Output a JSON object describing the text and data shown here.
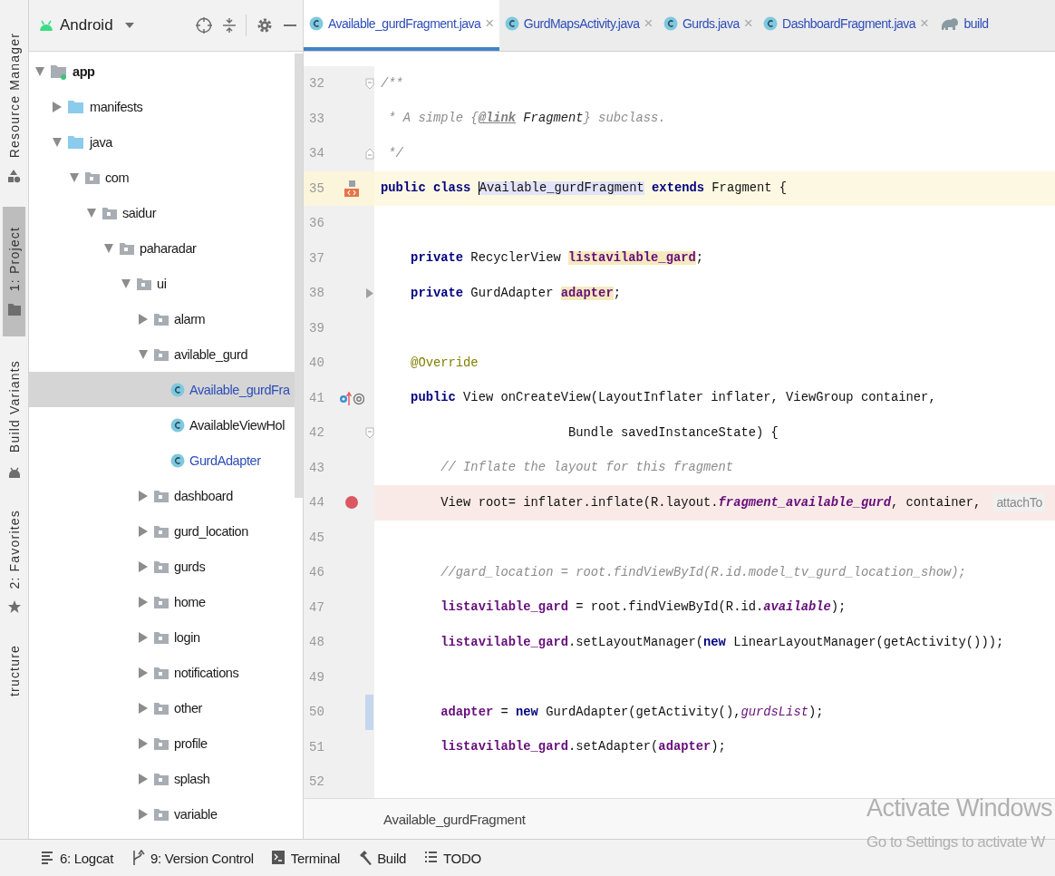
{
  "tool_stripe": [
    {
      "label": "Resource Manager",
      "selected": false
    },
    {
      "label": "1: Project",
      "selected": true
    },
    {
      "label": "Build Variants",
      "selected": false
    },
    {
      "label": "2: Favorites",
      "selected": false
    },
    {
      "label": "tructure",
      "selected": false
    }
  ],
  "project": {
    "view": "Android",
    "tree": [
      {
        "label": "app",
        "kind": "module",
        "expanded": true,
        "selected": false,
        "modified": false,
        "children": [
          {
            "label": "manifests",
            "kind": "source",
            "expanded": false,
            "selected": false,
            "modified": false
          },
          {
            "label": "java",
            "kind": "source",
            "expanded": true,
            "selected": false,
            "modified": false,
            "children": [
              {
                "label": "com",
                "kind": "package",
                "expanded": true,
                "selected": false,
                "modified": false,
                "children": [
                  {
                    "label": "saidur",
                    "kind": "package",
                    "expanded": true,
                    "selected": false,
                    "modified": false,
                    "children": [
                      {
                        "label": "paharadar",
                        "kind": "package",
                        "expanded": true,
                        "selected": false,
                        "modified": false,
                        "children": [
                          {
                            "label": "ui",
                            "kind": "package",
                            "expanded": true,
                            "selected": false,
                            "modified": false,
                            "children": [
                              {
                                "label": "alarm",
                                "kind": "package",
                                "expanded": false,
                                "selected": false,
                                "modified": false
                              },
                              {
                                "label": "avilable_gurd",
                                "kind": "package",
                                "expanded": true,
                                "selected": false,
                                "modified": false,
                                "children": [
                                  {
                                    "label": "Available_gurdFra",
                                    "kind": "class",
                                    "selected": true,
                                    "modified": true
                                  },
                                  {
                                    "label": "AvailableViewHol",
                                    "kind": "class",
                                    "selected": false,
                                    "modified": false
                                  },
                                  {
                                    "label": "GurdAdapter",
                                    "kind": "class",
                                    "selected": false,
                                    "modified": true
                                  }
                                ]
                              },
                              {
                                "label": "dashboard",
                                "kind": "package",
                                "expanded": false,
                                "selected": false,
                                "modified": false
                              },
                              {
                                "label": "gurd_location",
                                "kind": "package",
                                "expanded": false,
                                "selected": false,
                                "modified": false
                              },
                              {
                                "label": "gurds",
                                "kind": "package",
                                "expanded": false,
                                "selected": false,
                                "modified": false
                              },
                              {
                                "label": "home",
                                "kind": "package",
                                "expanded": false,
                                "selected": false,
                                "modified": false
                              },
                              {
                                "label": "login",
                                "kind": "package",
                                "expanded": false,
                                "selected": false,
                                "modified": false
                              },
                              {
                                "label": "notifications",
                                "kind": "package",
                                "expanded": false,
                                "selected": false,
                                "modified": false
                              },
                              {
                                "label": "other",
                                "kind": "package",
                                "expanded": false,
                                "selected": false,
                                "modified": false
                              },
                              {
                                "label": "profile",
                                "kind": "package",
                                "expanded": false,
                                "selected": false,
                                "modified": false
                              },
                              {
                                "label": "splash",
                                "kind": "package",
                                "expanded": false,
                                "selected": false,
                                "modified": false
                              },
                              {
                                "label": "variable",
                                "kind": "package",
                                "expanded": false,
                                "selected": false,
                                "modified": false
                              }
                            ]
                          }
                        ]
                      }
                    ]
                  }
                ]
              }
            ]
          }
        ]
      }
    ]
  },
  "tabs": [
    {
      "label": "Available_gurdFragment.java",
      "kind": "class",
      "selected": true,
      "close": "×"
    },
    {
      "label": "GurdMapsActivity.java",
      "kind": "class",
      "selected": false,
      "close": "×"
    },
    {
      "label": "Gurds.java",
      "kind": "class",
      "selected": false,
      "close": "×"
    },
    {
      "label": "DashboardFragment.java",
      "kind": "class",
      "selected": false,
      "close": "×"
    },
    {
      "label": "build",
      "kind": "gradle",
      "selected": false
    }
  ],
  "code": {
    "lines": [
      {
        "number": "32",
        "current": false,
        "changed": false,
        "fold_mark": {
          "kind": "open"
        },
        "tokens": [
          {
            "kind": "doc",
            "text": "/**"
          }
        ]
      },
      {
        "number": "33",
        "current": false,
        "changed": false,
        "tokens": [
          {
            "kind": "doc",
            "text": " * A simple {"
          },
          {
            "kind": "doc_tag",
            "text": "@link"
          },
          {
            "kind": "doc_ref",
            "text": " Fragment"
          },
          {
            "kind": "doc",
            "text": "} subclass."
          }
        ]
      },
      {
        "number": "34",
        "current": false,
        "changed": false,
        "fold_mark": {
          "kind": "close"
        },
        "tokens": [
          {
            "kind": "doc",
            "text": " */"
          }
        ]
      },
      {
        "number": "35",
        "current": true,
        "changed": false,
        "gutter_mark": {
          "kind": "implemented"
        },
        "tokens": [
          {
            "kind": "kw",
            "text": "public class "
          },
          {
            "kind": "usage",
            "text": "Available_gurdFragment"
          },
          {
            "kind": "kw",
            "text": " extends"
          },
          {
            "kind": "plain",
            "text": " Fragment {"
          }
        ]
      },
      {
        "number": "36",
        "current": false,
        "changed": false
      },
      {
        "number": "37",
        "current": false,
        "changed": false,
        "tokens": [
          {
            "kind": "kw",
            "text": "    private"
          },
          {
            "kind": "plain",
            "text": " RecyclerView "
          },
          {
            "kind": "decl_field",
            "text": "listavilable_gard"
          },
          {
            "kind": "plain",
            "text": ";"
          }
        ]
      },
      {
        "number": "38",
        "current": false,
        "changed": false,
        "fold_mark": {
          "kind": "arrow"
        },
        "tokens": [
          {
            "kind": "kw",
            "text": "    private"
          },
          {
            "kind": "plain",
            "text": " GurdAdapter "
          },
          {
            "kind": "decl_field",
            "text": "adapter"
          },
          {
            "kind": "plain",
            "text": ";"
          }
        ]
      },
      {
        "number": "39",
        "current": false,
        "changed": false
      },
      {
        "number": "40",
        "current": false,
        "changed": false,
        "tokens": [
          {
            "kind": "annotation",
            "text": "    @Override"
          }
        ]
      },
      {
        "number": "41",
        "current": false,
        "changed": false,
        "gutter_mark": {
          "kind": "override"
        },
        "tokens": [
          {
            "kind": "kw",
            "text": "    public"
          },
          {
            "kind": "plain",
            "text": " View onCreateView(LayoutInflater inflater, ViewGroup container,"
          }
        ]
      },
      {
        "number": "42",
        "current": false,
        "changed": false,
        "fold_mark": {
          "kind": "open"
        },
        "tokens": [
          {
            "kind": "plain",
            "text": "                         Bundle savedInstanceState) {"
          }
        ]
      },
      {
        "number": "43",
        "current": false,
        "changed": false,
        "tokens": [
          {
            "kind": "comment",
            "text": "        // Inflate the layout for this fragment"
          }
        ]
      },
      {
        "number": "44",
        "current": false,
        "changed": false,
        "gutter_mark": {
          "kind": "breakpoint"
        },
        "tokens": [
          {
            "kind": "plain",
            "text": "        View root= inflater.inflate(R.layout."
          },
          {
            "kind": "field_italic",
            "text": "fragment_available_gurd"
          },
          {
            "kind": "plain",
            "text": ", container,"
          }
        ],
        "hint": "attachTo"
      },
      {
        "number": "45",
        "current": false,
        "changed": false
      },
      {
        "number": "46",
        "current": false,
        "changed": false,
        "tokens": [
          {
            "kind": "comment",
            "text": "        //gard_location = root.findViewById(R.id.model_tv_gurd_location_show);"
          }
        ]
      },
      {
        "number": "47",
        "current": false,
        "changed": false,
        "tokens": [
          {
            "kind": "field",
            "text": "        listavilable_gard"
          },
          {
            "kind": "plain",
            "text": " = root.findViewById(R.id."
          },
          {
            "kind": "field_italic",
            "text": "available"
          },
          {
            "kind": "plain",
            "text": ");"
          }
        ]
      },
      {
        "number": "48",
        "current": false,
        "changed": false,
        "tokens": [
          {
            "kind": "field",
            "text": "        listavilable_gard"
          },
          {
            "kind": "plain",
            "text": ".setLayoutManager("
          },
          {
            "kind": "kw",
            "text": "new"
          },
          {
            "kind": "plain",
            "text": " LinearLayoutManager(getActivity()));"
          }
        ]
      },
      {
        "number": "49",
        "current": false,
        "changed": false
      },
      {
        "number": "50",
        "current": false,
        "changed": true,
        "tokens": [
          {
            "kind": "field",
            "text": "        adapter"
          },
          {
            "kind": "plain",
            "text": " = "
          },
          {
            "kind": "kw",
            "text": "new"
          },
          {
            "kind": "plain",
            "text": " GurdAdapter(getActivity(),"
          },
          {
            "kind": "static_italic",
            "text": "gurdsList"
          },
          {
            "kind": "plain",
            "text": ");"
          }
        ]
      },
      {
        "number": "51",
        "current": false,
        "changed": false,
        "tokens": [
          {
            "kind": "field",
            "text": "        listavilable_gard"
          },
          {
            "kind": "plain",
            "text": ".setAdapter("
          },
          {
            "kind": "field",
            "text": "adapter"
          },
          {
            "kind": "plain",
            "text": ");"
          }
        ]
      },
      {
        "number": "52",
        "current": false,
        "changed": false
      }
    ]
  },
  "breadcrumb": "Available_gurdFragment",
  "bottom_tools": [
    {
      "label": "6: Logcat"
    },
    {
      "label": "9: Version Control"
    },
    {
      "label": "Terminal"
    },
    {
      "label": "Build"
    },
    {
      "label": "TODO"
    }
  ],
  "os_overlay": {
    "title": "Activate Windows",
    "subtitle": "Go to Settings to activate W"
  }
}
